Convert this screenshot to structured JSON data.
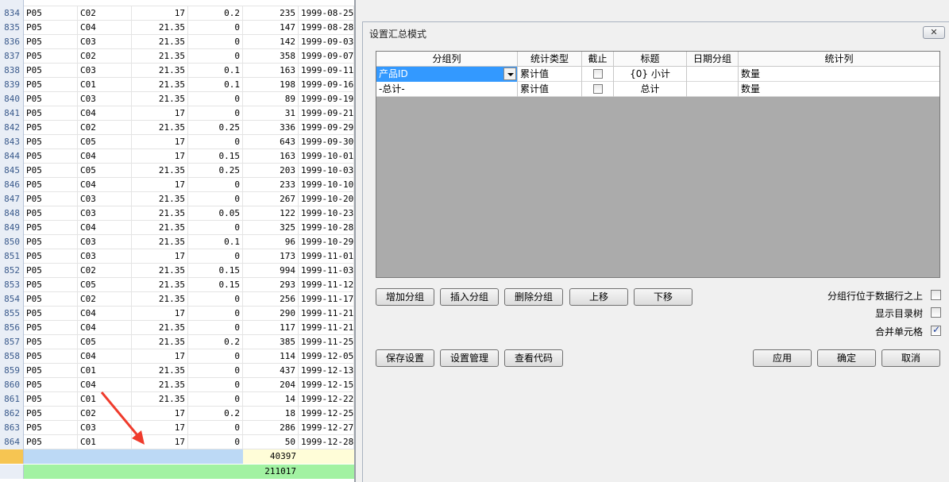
{
  "grid": {
    "rows": [
      {
        "n": "834",
        "a": "P05",
        "b": "C02",
        "c": "17",
        "d": "0.2",
        "e": "235",
        "f": "1999-08-25"
      },
      {
        "n": "835",
        "a": "P05",
        "b": "C04",
        "c": "21.35",
        "d": "0",
        "e": "147",
        "f": "1999-08-28"
      },
      {
        "n": "836",
        "a": "P05",
        "b": "C03",
        "c": "21.35",
        "d": "0",
        "e": "142",
        "f": "1999-09-03"
      },
      {
        "n": "837",
        "a": "P05",
        "b": "C02",
        "c": "21.35",
        "d": "0",
        "e": "358",
        "f": "1999-09-07"
      },
      {
        "n": "838",
        "a": "P05",
        "b": "C03",
        "c": "21.35",
        "d": "0.1",
        "e": "163",
        "f": "1999-09-11"
      },
      {
        "n": "839",
        "a": "P05",
        "b": "C01",
        "c": "21.35",
        "d": "0.1",
        "e": "198",
        "f": "1999-09-16"
      },
      {
        "n": "840",
        "a": "P05",
        "b": "C03",
        "c": "21.35",
        "d": "0",
        "e": "89",
        "f": "1999-09-19"
      },
      {
        "n": "841",
        "a": "P05",
        "b": "C04",
        "c": "17",
        "d": "0",
        "e": "31",
        "f": "1999-09-21"
      },
      {
        "n": "842",
        "a": "P05",
        "b": "C02",
        "c": "21.35",
        "d": "0.25",
        "e": "336",
        "f": "1999-09-29"
      },
      {
        "n": "843",
        "a": "P05",
        "b": "C05",
        "c": "17",
        "d": "0",
        "e": "643",
        "f": "1999-09-30"
      },
      {
        "n": "844",
        "a": "P05",
        "b": "C04",
        "c": "17",
        "d": "0.15",
        "e": "163",
        "f": "1999-10-01"
      },
      {
        "n": "845",
        "a": "P05",
        "b": "C05",
        "c": "21.35",
        "d": "0.25",
        "e": "203",
        "f": "1999-10-03"
      },
      {
        "n": "846",
        "a": "P05",
        "b": "C04",
        "c": "17",
        "d": "0",
        "e": "233",
        "f": "1999-10-10"
      },
      {
        "n": "847",
        "a": "P05",
        "b": "C03",
        "c": "21.35",
        "d": "0",
        "e": "267",
        "f": "1999-10-20"
      },
      {
        "n": "848",
        "a": "P05",
        "b": "C03",
        "c": "21.35",
        "d": "0.05",
        "e": "122",
        "f": "1999-10-23"
      },
      {
        "n": "849",
        "a": "P05",
        "b": "C04",
        "c": "21.35",
        "d": "0",
        "e": "325",
        "f": "1999-10-28"
      },
      {
        "n": "850",
        "a": "P05",
        "b": "C03",
        "c": "21.35",
        "d": "0.1",
        "e": "96",
        "f": "1999-10-29"
      },
      {
        "n": "851",
        "a": "P05",
        "b": "C03",
        "c": "17",
        "d": "0",
        "e": "173",
        "f": "1999-11-01"
      },
      {
        "n": "852",
        "a": "P05",
        "b": "C02",
        "c": "21.35",
        "d": "0.15",
        "e": "994",
        "f": "1999-11-03"
      },
      {
        "n": "853",
        "a": "P05",
        "b": "C05",
        "c": "21.35",
        "d": "0.15",
        "e": "293",
        "f": "1999-11-12"
      },
      {
        "n": "854",
        "a": "P05",
        "b": "C02",
        "c": "21.35",
        "d": "0",
        "e": "256",
        "f": "1999-11-17"
      },
      {
        "n": "855",
        "a": "P05",
        "b": "C04",
        "c": "17",
        "d": "0",
        "e": "290",
        "f": "1999-11-21"
      },
      {
        "n": "856",
        "a": "P05",
        "b": "C04",
        "c": "21.35",
        "d": "0",
        "e": "117",
        "f": "1999-11-21"
      },
      {
        "n": "857",
        "a": "P05",
        "b": "C05",
        "c": "21.35",
        "d": "0.2",
        "e": "385",
        "f": "1999-11-25"
      },
      {
        "n": "858",
        "a": "P05",
        "b": "C04",
        "c": "17",
        "d": "0",
        "e": "114",
        "f": "1999-12-05"
      },
      {
        "n": "859",
        "a": "P05",
        "b": "C01",
        "c": "21.35",
        "d": "0",
        "e": "437",
        "f": "1999-12-13"
      },
      {
        "n": "860",
        "a": "P05",
        "b": "C04",
        "c": "21.35",
        "d": "0",
        "e": "204",
        "f": "1999-12-15"
      },
      {
        "n": "861",
        "a": "P05",
        "b": "C01",
        "c": "21.35",
        "d": "0",
        "e": "14",
        "f": "1999-12-22"
      },
      {
        "n": "862",
        "a": "P05",
        "b": "C02",
        "c": "17",
        "d": "0.2",
        "e": "18",
        "f": "1999-12-25"
      },
      {
        "n": "863",
        "a": "P05",
        "b": "C03",
        "c": "17",
        "d": "0",
        "e": "286",
        "f": "1999-12-27"
      },
      {
        "n": "864",
        "a": "P05",
        "b": "C01",
        "c": "17",
        "d": "0",
        "e": "50",
        "f": "1999-12-28"
      }
    ],
    "subtotal": "40397",
    "grand_total": "211017",
    "colors": {
      "subtotal_bg": "#bcd9f5",
      "subtotal_value_bg": "#fffdd8",
      "total_bg": "#a2f2a2",
      "arrow": "#ef3b2c"
    }
  },
  "dialog": {
    "title": "设置汇总模式",
    "close_icon": "close-icon",
    "columns": [
      "分组列",
      "统计类型",
      "截止",
      "标题",
      "日期分组",
      "统计列"
    ],
    "rows": [
      {
        "group_col": "产品ID",
        "stat_type": "累计值",
        "cutoff": false,
        "caption": "{0} 小计",
        "date_group": "",
        "stat_col": "数量"
      },
      {
        "group_col": "-总计-",
        "stat_type": "累计值",
        "cutoff": false,
        "caption": "总计",
        "date_group": "",
        "stat_col": "数量"
      }
    ],
    "buttons_row1": [
      "增加分组",
      "插入分组",
      "删除分组",
      "上移",
      "下移"
    ],
    "buttons_row2": [
      "保存设置",
      "设置管理",
      "查看代码"
    ],
    "buttons_right": [
      "应用",
      "确定",
      "取消"
    ],
    "options": [
      {
        "label": "分组行位于数据行之上",
        "checked": false
      },
      {
        "label": "显示目录树",
        "checked": false
      },
      {
        "label": "合并单元格",
        "checked": true
      }
    ],
    "check_glyph": "✓"
  }
}
